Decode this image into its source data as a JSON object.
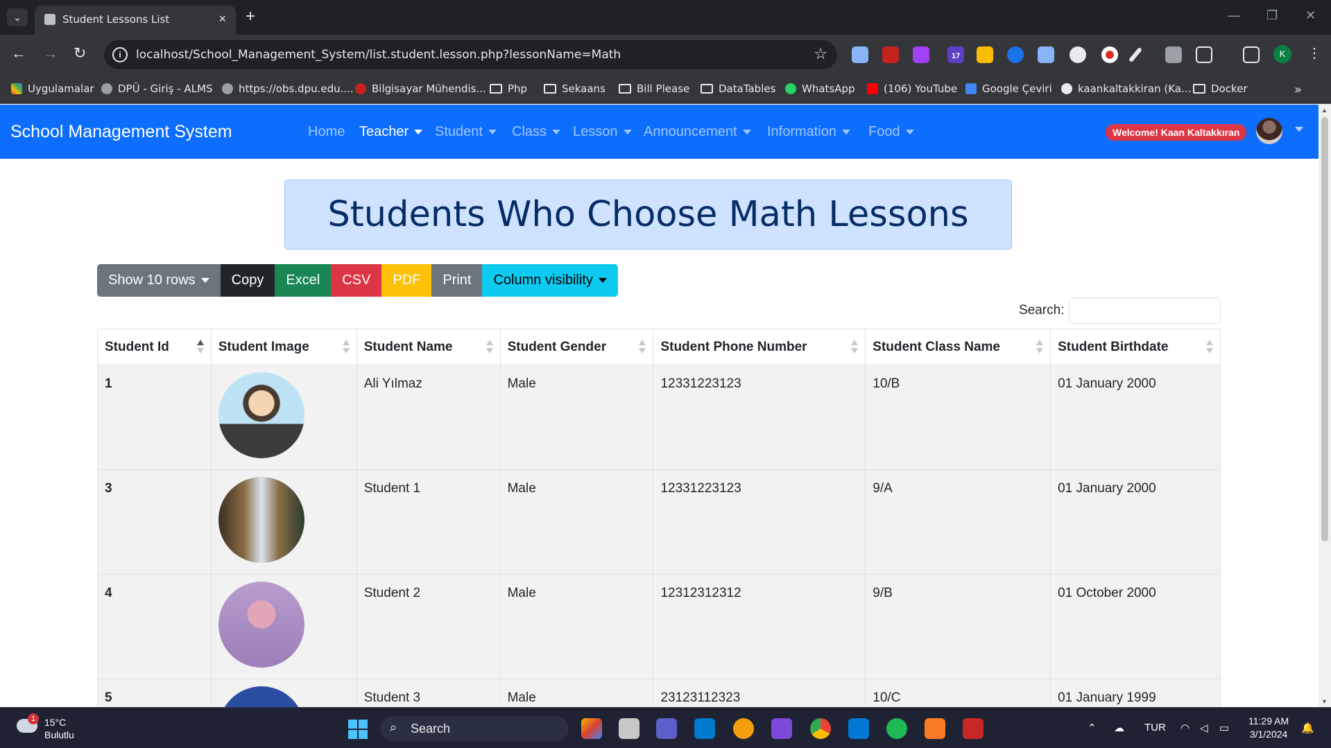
{
  "browser": {
    "tab_title": "Student Lessons List",
    "url": "localhost/School_Management_System/list.student.lesson.php?lessonName=Math",
    "profile_initial": "K",
    "bookmarks": [
      "Uygulamalar",
      "DPÜ - Giriş - ALMS",
      "https://obs.dpu.edu....",
      "Bilgisayar Mühendis...",
      "Php",
      "Sekaans",
      "Bill Please",
      "DataTables",
      "WhatsApp",
      "(106) YouTube",
      "Google Çeviri",
      "kaankaltakkiran (Ka...",
      "Docker"
    ],
    "extension_badge": "17"
  },
  "navbar": {
    "brand": "School Management System",
    "items": [
      "Home",
      "Teacher",
      "Student",
      "Class",
      "Lesson",
      "Announcement",
      "Information",
      "Food"
    ],
    "active": "Teacher",
    "welcome": "Welcome! Kaan Kaltakkıran"
  },
  "page": {
    "heading": "Students Who Choose Math Lessons",
    "buttons": [
      "Show 10 rows",
      "Copy",
      "Excel",
      "CSV",
      "PDF",
      "Print",
      "Column visibility"
    ],
    "search_label": "Search:",
    "search_value": ""
  },
  "table": {
    "columns": [
      "Student Id",
      "Student Image",
      "Student Name",
      "Student Gender",
      "Student Phone Number",
      "Student Class Name",
      "Student Birthdate"
    ],
    "sorted_column": "Student Id",
    "rows": [
      {
        "id": "1",
        "name": "Ali Yılmaz",
        "gender": "Male",
        "phone": "12331223123",
        "class": "10/B",
        "birthdate": "01 January 2000"
      },
      {
        "id": "3",
        "name": "Student 1",
        "gender": "Male",
        "phone": "12331223123",
        "class": "9/A",
        "birthdate": "01 January 2000"
      },
      {
        "id": "4",
        "name": "Student 2",
        "gender": "Male",
        "phone": "12312312312",
        "class": "9/B",
        "birthdate": "01 October 2000"
      },
      {
        "id": "5",
        "name": "Student 3",
        "gender": "Male",
        "phone": "23123112323",
        "class": "10/C",
        "birthdate": "01 January 1999"
      }
    ]
  },
  "taskbar": {
    "weather_temp": "15°C",
    "weather_desc": "Bulutlu",
    "weather_badge": "1",
    "search_label": "Search",
    "language": "TUR",
    "time": "11:29 AM",
    "date": "3/1/2024"
  },
  "colors": {
    "primary": "#0d6efd",
    "danger": "#dc3545",
    "success": "#198754",
    "warning": "#ffc107",
    "info": "#0dcaf0",
    "secondary": "#6c757d"
  }
}
